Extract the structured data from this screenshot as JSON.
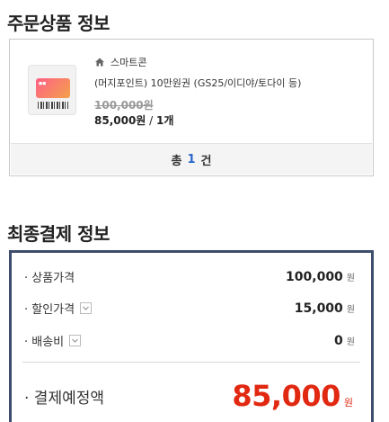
{
  "order_section": {
    "title": "주문상품 정보",
    "item": {
      "thumb_icon": "gift-card-icon",
      "brand_icon": "home-icon",
      "brand": "스마트콘",
      "name": "(머지포인트) 10만원권 (GS25/이디야/토다이 등)",
      "original_price": "100,000원",
      "price": "85,000원",
      "separator": " / ",
      "quantity": "1개"
    },
    "total": {
      "prefix": "총",
      "count": "1",
      "suffix": "건",
      "count_color": "#2a66c9"
    }
  },
  "payment_section": {
    "title": "최종결제 정보",
    "rows": [
      {
        "label": "· 상품가격",
        "value": "100,000",
        "unit": "원",
        "has_toggle": false
      },
      {
        "label": "· 할인가격",
        "value": "15,000",
        "unit": "원",
        "has_toggle": true,
        "toggle_icon": "chevron-down-icon"
      },
      {
        "label": "· 배송비",
        "value": "0",
        "unit": "원",
        "has_toggle": true,
        "toggle_icon": "chevron-down-icon"
      }
    ],
    "final": {
      "label": "· 결제예정액",
      "value": "85,000",
      "unit": "원",
      "color": "#e12810"
    },
    "border_color": "#3d4d6d"
  }
}
